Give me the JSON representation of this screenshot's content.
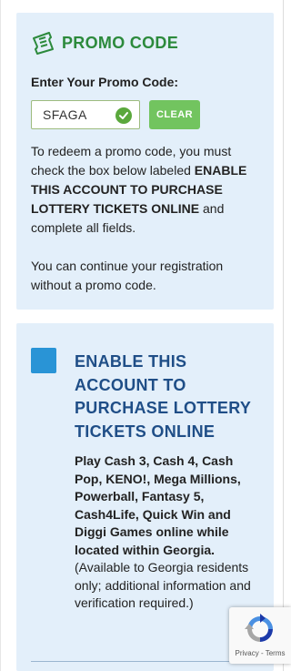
{
  "promo": {
    "title": "PROMO CODE",
    "label": "Enter Your Promo Code:",
    "code_value": "SFAGA",
    "clear_label": "CLEAR",
    "desc_before": "To redeem a promo code, you must check the box below labeled ",
    "desc_bold": "ENABLE THIS ACCOUNT TO PURCHASE LOTTERY TICKETS ONLINE",
    "desc_after": " and complete all fields.",
    "note": "You can continue your registration without a promo code."
  },
  "enable": {
    "title": "ENABLE THIS ACCOUNT TO PURCHASE LOTTERY TICKETS ONLINE",
    "body_bold": "Play Cash 3, Cash 4, Cash Pop, KENO!, Mega Millions, Powerball, Fantasy 5, Cash4Life, Quick Win and Diggi Games online while located within Georgia.",
    "body_rest": " (Available to Georgia residents only; additional information and verification required.)",
    "checked": false
  },
  "recaptcha": {
    "privacy": "Privacy",
    "separator": " - ",
    "terms": "Terms"
  },
  "colors": {
    "card_bg": "#e3effa",
    "promo_green": "#2c8a3c",
    "clear_green": "#72c45f",
    "checkbox_blue": "#2994d6",
    "title_navy": "#1f4e87"
  },
  "icons": {
    "promo": "ticket-icon",
    "valid": "check-circle-icon",
    "captcha": "recaptcha-logo-icon"
  }
}
